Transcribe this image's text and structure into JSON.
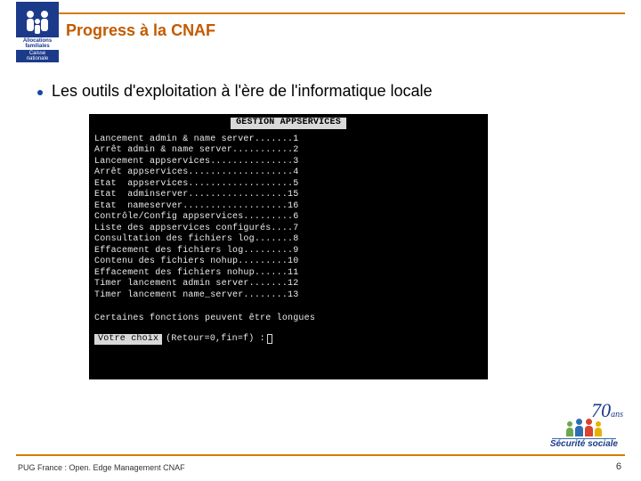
{
  "header": {
    "title": "Progress à la CNAF",
    "logo_label1": "Allocations familiales",
    "logo_label2": "Caisse nationale"
  },
  "bullet": {
    "text": "Les outils d'exploitation à l'ère de l'informatique locale"
  },
  "terminal": {
    "header": "GESTION APPSERVICES",
    "lines": [
      "Lancement admin & name server.......1",
      "Arrêt admin & name server...........2",
      "Lancement appservices...............3",
      "Arrêt appservices...................4",
      "Etat  appservices...................5",
      "Etat  adminserver..................15",
      "Etat  nameserver...................16",
      "Contrôle/Config appservices.........6",
      "Liste des appservices configurés....7",
      "Consultation des fichiers log.......8",
      "Effacement des fichiers log.........9",
      "Contenu des fichiers nohup.........10",
      "Effacement des fichiers nohup......11",
      "Timer lancement admin server.......12",
      "Timer lancement name_server........13"
    ],
    "footer_note": "Certaines fonctions peuvent être longues",
    "prompt_inv": "Votre choix",
    "prompt_rest": "(Retour=0,fin=f) :"
  },
  "footer": {
    "left": "PUG France : Open. Edge Management CNAF",
    "page": "6",
    "secu_line1": "Sécurité",
    "secu_line2": "sociale",
    "anniv": "70",
    "anniv_suffix": "ans"
  },
  "colors": {
    "accent": "#d67a00",
    "title": "#c35a00",
    "brand_blue": "#1b3a8a"
  }
}
